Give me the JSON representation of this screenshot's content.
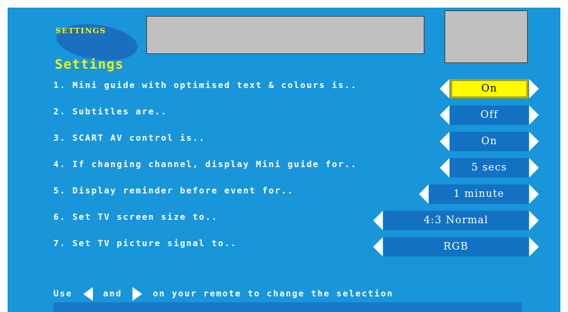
{
  "logo": {
    "text": "SETTINGS"
  },
  "heading": "Settings",
  "rows": [
    {
      "label": "1. Mini guide with optimised text & colours is..",
      "value": "On",
      "selected": true
    },
    {
      "label": "2. Subtitles are..",
      "value": "Off"
    },
    {
      "label": "3. SCART AV control is..",
      "value": "On"
    },
    {
      "label": "4. If changing channel, display Mini guide for..",
      "value": "5 secs"
    },
    {
      "label": "5. Display reminder before event for..",
      "value": "1 minute"
    },
    {
      "label": "6. Set TV screen size to..",
      "value": "4:3 Normal"
    },
    {
      "label": "7. Set TV picture signal to..",
      "value": "RGB"
    }
  ],
  "footer": {
    "use": "Use",
    "and": "and",
    "rest": "on your remote to change the selection"
  },
  "colors": {
    "background": "#1995da",
    "accent": "#f5f20c",
    "selected": "#fffb00",
    "value_box": "#1371c4"
  }
}
